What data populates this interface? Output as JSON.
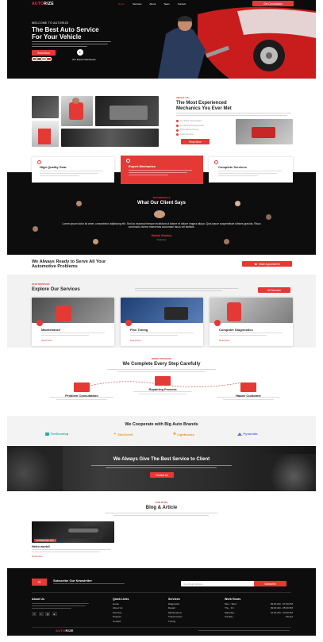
{
  "header": {
    "logo_a": "AUTO",
    "logo_b": "RIZE",
    "nav": [
      "Home",
      "Services",
      "About",
      "Team",
      "Contact"
    ],
    "cta": "Get Consultation"
  },
  "hero": {
    "eyebrow": "WELCOME TO AUTORIZE",
    "title_line1": "The Best Auto Service",
    "title_line2": "For Your Vehicle",
    "button": "Read More",
    "experts_label": "Our Expert Mechanics"
  },
  "about": {
    "eyebrow": "ABOUT US",
    "title_line1": "The Most Experienced",
    "title_line2": "Mechanics You Ever Met",
    "checks": [
      "Certified Technicians",
      "Professional Approach",
      "Affordable Pricing",
      "Fast Service"
    ],
    "button": "Read More"
  },
  "features": [
    {
      "title": "High Quality Gear"
    },
    {
      "title": "Expert Mechanics"
    },
    {
      "title": "Complete Services"
    }
  ],
  "testimonials": {
    "eyebrow": "TESTIMONIALS",
    "title": "What Our Client Says",
    "quote": "Lorem ipsum dolor sit amet, consectetur adipiscing elit. Sed do eiusmod tempor incididunt ut labore et dolore magna aliqua. Quis ipsum suspendisse ultrices gravida. Risus commodo viverra maecenas accumsan lacus vel facilisis.",
    "name": "Mariah Bradley",
    "role": "Customer"
  },
  "appointment": {
    "title_line1": "We Always Ready to Serve All Your",
    "title_line2": "Automotive Problems",
    "button": "Make Appointment"
  },
  "services": {
    "eyebrow": "OUR SERVICES",
    "title": "Explore Our Services",
    "button": "All Services",
    "items": [
      {
        "title": "Maintenance",
        "more": "Read More"
      },
      {
        "title": "Fine Tuning",
        "more": "Read More"
      },
      {
        "title": "Computer Diagnostics",
        "more": "Read More"
      }
    ]
  },
  "process": {
    "eyebrow": "WORK PROCESS",
    "title": "We Complete Every Step Carefully",
    "steps": [
      {
        "title": "Problem Consultation"
      },
      {
        "title": "Repairing Process"
      },
      {
        "title": "Happy Customer"
      }
    ]
  },
  "brands": {
    "title": "We Cooperate with Big Auto Brands",
    "items": [
      "TheDevelop",
      "StarScraft",
      "Lighthouse",
      "Pyramida"
    ]
  },
  "promo": {
    "title": "We Always Give The Best Service to Client",
    "button": "Contact Us"
  },
  "blog": {
    "eyebrow": "OUR BLOG",
    "title": "Blog & Article",
    "post_badge": "AUTOMOTIVE TIPS",
    "post_title": "Hello world!",
    "post_more": "Read More"
  },
  "footer": {
    "newsletter_title": "Subscribe Our Newsletter",
    "email_placeholder": "Your Email Address",
    "subscribe": "Subscribe",
    "col_about": "About Us",
    "col_links": "Quick Links",
    "links": [
      "Home",
      "About Us",
      "Services",
      "Projects",
      "Contact"
    ],
    "col_services": "Services",
    "services": [
      "Diagnostic",
      "Repair",
      "Maintenance",
      "Transmission",
      "Tuning"
    ],
    "col_hours": "Work Hours",
    "hours": [
      {
        "day": "Mon - Wed :",
        "time": "09:00 AM - 07:00 PM"
      },
      {
        "day": "Thu - Fri :",
        "time": "09:00 AM - 05:00 PM"
      },
      {
        "day": "Saturday :",
        "time": "10:00 AM - 03:00 PM"
      },
      {
        "day": "Sunday :",
        "time": "Closed"
      }
    ],
    "bottom_logo_a": "AUTO",
    "bottom_logo_b": "RIZE"
  },
  "colors": {
    "accent": "#e53935",
    "dark": "#0d0d0d"
  }
}
